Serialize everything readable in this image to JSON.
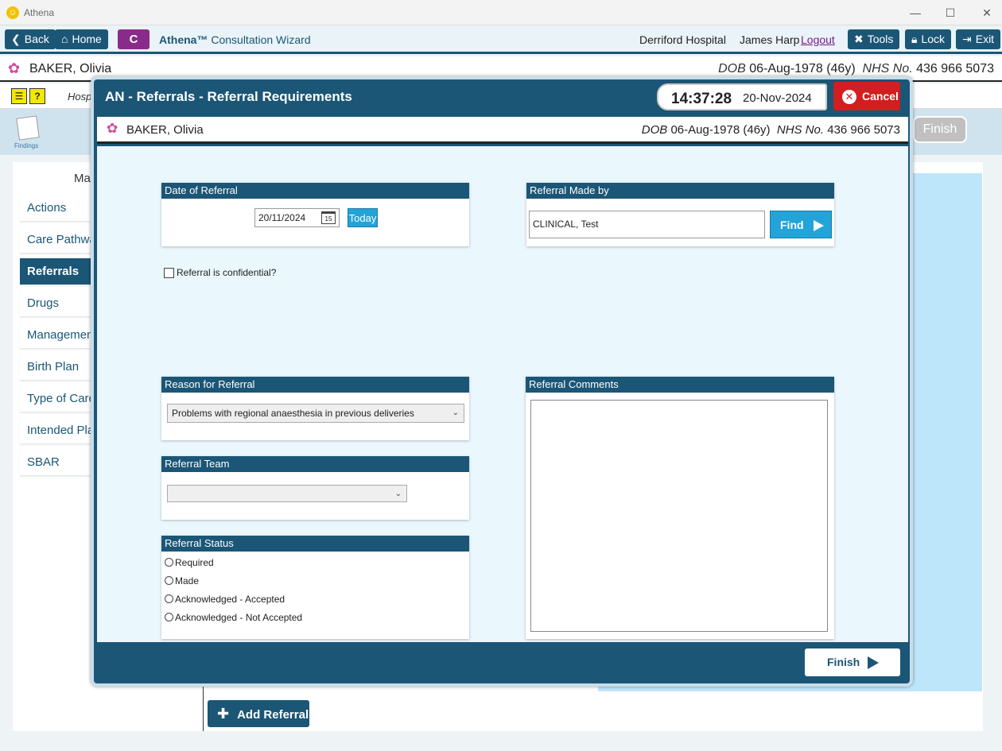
{
  "window": {
    "title": "Athena"
  },
  "toolbar": {
    "back_label": "Back",
    "home_label": "Home",
    "c_label": "C",
    "wizard_brand": "Athena™",
    "wizard_title": "Consultation Wizard",
    "hospital": "Derriford Hospital",
    "user": "James Harp",
    "logout_label": "Logout",
    "tools_label": "Tools",
    "lock_label": "Lock",
    "exit_label": "Exit"
  },
  "patient": {
    "name": "BAKER, Olivia",
    "dob_label": "DOB",
    "dob": "06-Aug-1978 (46y)",
    "nhs_label": "NHS No.",
    "nhs": "436 966 5073"
  },
  "strip": {
    "hospital_partial": "Hosp",
    "findings_label": "Findings",
    "finish_label": "Finish"
  },
  "sidebar": {
    "title_partial": "Mar",
    "items": [
      {
        "label": "Actions"
      },
      {
        "label": "Care Pathwa"
      },
      {
        "label": "Referrals"
      },
      {
        "label": "Drugs"
      },
      {
        "label": "Managemen"
      },
      {
        "label": "Birth Plan"
      },
      {
        "label": "Type of Care"
      },
      {
        "label": "Intended Pla"
      },
      {
        "label": "SBAR"
      }
    ]
  },
  "add_referral_label": "Add Referral",
  "modal": {
    "title": "AN - Referrals - Referral Requirements",
    "time": "14:37:28",
    "date": "20-Nov-2024",
    "cancel_label": "Cancel",
    "finish_label": "Finish",
    "date_of_referral": {
      "header": "Date of Referral",
      "value": "20/11/2024",
      "cal_day": "15",
      "today_label": "Today"
    },
    "made_by": {
      "header": "Referral Made by",
      "value": "CLINICAL, Test",
      "find_label": "Find"
    },
    "confidential_label": "Referral is confidential?",
    "reason": {
      "header": "Reason for Referral",
      "selected": "Problems with regional anaesthesia in previous deliveries"
    },
    "team": {
      "header": "Referral Team",
      "selected": ""
    },
    "status": {
      "header": "Referral Status",
      "options": [
        {
          "label": "Required"
        },
        {
          "label": "Made"
        },
        {
          "label": "Acknowledged - Accepted"
        },
        {
          "label": "Acknowledged - Not Accepted"
        }
      ]
    },
    "comments": {
      "header": "Referral Comments",
      "value": ""
    }
  }
}
